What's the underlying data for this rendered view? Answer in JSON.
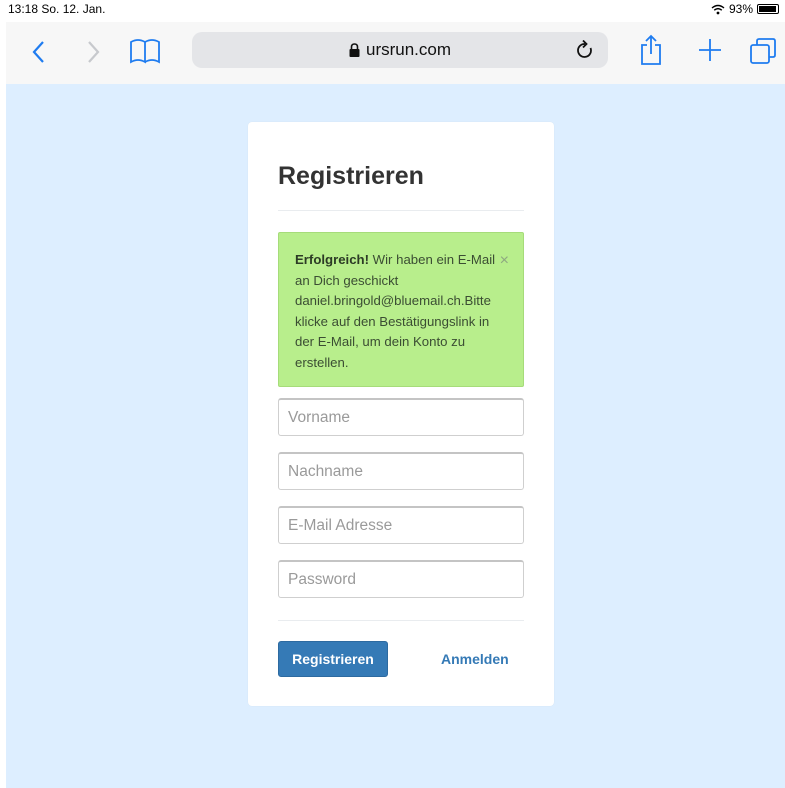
{
  "status_bar": {
    "time": "13:18  So. 12. Jan.",
    "battery": "93%",
    "wifi_icon": "wifi-icon",
    "battery_icon": "battery-icon"
  },
  "toolbar": {
    "url": "ursrun.com",
    "icons": {
      "back": "chevron-left-icon",
      "forward": "chevron-right-icon",
      "bookmarks": "book-icon",
      "lock": "lock-icon",
      "reload": "reload-icon",
      "share": "share-icon",
      "new_tab": "plus-icon",
      "tabs": "tabs-icon"
    },
    "accent_color": "#1f7cf0"
  },
  "form": {
    "title": "Registrieren",
    "alert": {
      "strong": "Erfolgreich!",
      "message": " Wir haben ein E-Mail an Dich geschickt daniel.bringold@bluemail.ch.Bitte klicke auf den Bestätigungslink in der E-Mail, um dein Konto zu erstellen.",
      "close": "×",
      "background": "#b8ee8c"
    },
    "fields": {
      "firstname_placeholder": "Vorname",
      "lastname_placeholder": "Nachname",
      "email_placeholder": "E-Mail Adresse",
      "password_placeholder": "Password"
    },
    "register_label": "Registrieren",
    "login_label": "Anmelden",
    "primary_color": "#357ab6"
  },
  "page_background": "#ddeeff"
}
